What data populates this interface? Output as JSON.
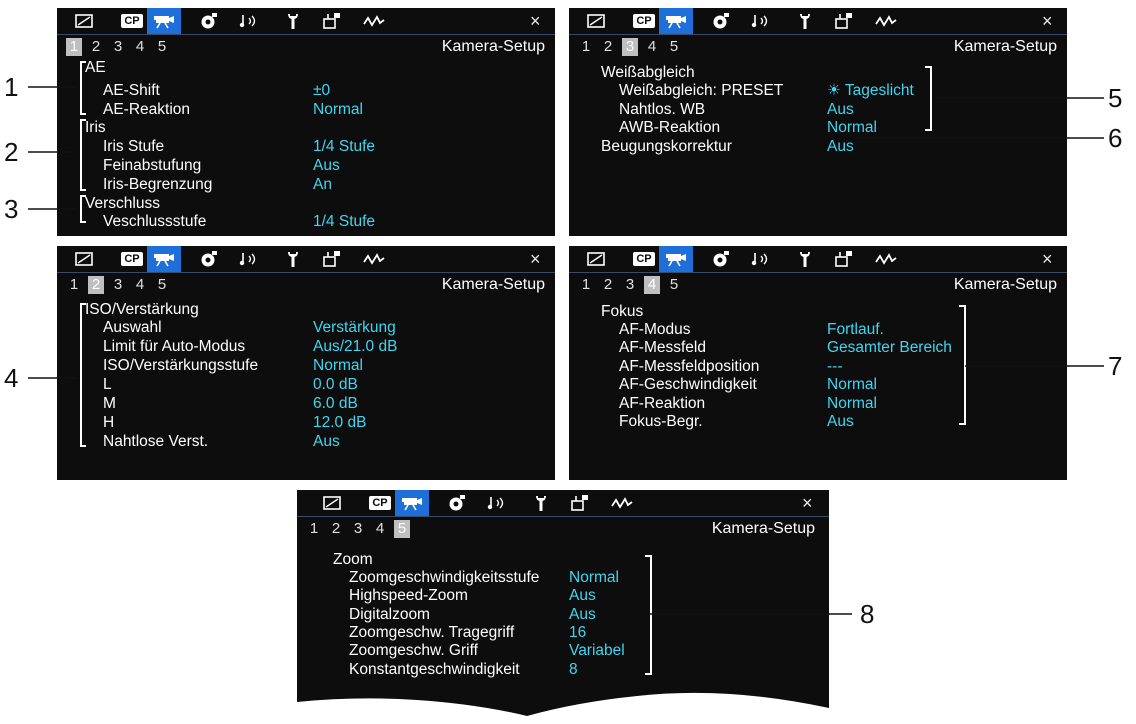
{
  "tabs": [
    {
      "name": "picture-icon"
    },
    {
      "name": "custom-picture-icon",
      "text": "CP"
    },
    {
      "name": "camera-icon"
    },
    {
      "name": "recording-icon"
    },
    {
      "name": "audio-icon"
    },
    {
      "name": "wrench-icon"
    },
    {
      "name": "assign-icon"
    },
    {
      "name": "wave-icon"
    }
  ],
  "close_label": "×",
  "menu_title": "Kamera-Setup",
  "page_numbers": [
    "1",
    "2",
    "3",
    "4",
    "5"
  ],
  "accent_color": "#1f6fd8",
  "value_color": "#3fd6f0",
  "panels": [
    {
      "active_page": 0,
      "rows": [
        {
          "label": "AE",
          "value": ""
        },
        {
          "label": "AE-Shift",
          "value": "±0"
        },
        {
          "label": "AE-Reaktion",
          "value": "Normal"
        },
        {
          "label": "Iris",
          "value": ""
        },
        {
          "label": "Iris Stufe",
          "value": "1/4 Stufe"
        },
        {
          "label": "Feinabstufung",
          "value": "Aus"
        },
        {
          "label": "Iris-Begrenzung",
          "value": "An"
        },
        {
          "label": "Verschluss",
          "value": ""
        },
        {
          "label": "Veschlussstufe",
          "value": "1/4 Stufe"
        }
      ]
    },
    {
      "active_page": 2,
      "rows": [
        {
          "label": "Weißabgleich",
          "value": ""
        },
        {
          "label": "Weißabgleich: PRESET",
          "value": "Tageslicht"
        },
        {
          "label": "Nahtlos. WB",
          "value": "Aus"
        },
        {
          "label": "AWB-Reaktion",
          "value": "Normal"
        },
        {
          "label": "Beugungskorrektur",
          "value": "Aus"
        }
      ]
    },
    {
      "active_page": 1,
      "rows": [
        {
          "label": "ISO/Verstärkung",
          "value": ""
        },
        {
          "label": "Auswahl",
          "value": "Verstärkung"
        },
        {
          "label": "Limit für Auto-Modus",
          "value": "Aus/21.0 dB"
        },
        {
          "label": "ISO/Verstärkungsstufe",
          "value": "Normal"
        },
        {
          "label": "L",
          "value": "0.0 dB"
        },
        {
          "label": "M",
          "value": "6.0 dB"
        },
        {
          "label": "H",
          "value": "12.0 dB"
        },
        {
          "label": "Nahtlose Verst.",
          "value": "Aus"
        }
      ]
    },
    {
      "active_page": 3,
      "rows": [
        {
          "label": "Fokus",
          "value": ""
        },
        {
          "label": "AF-Modus",
          "value": "Fortlauf."
        },
        {
          "label": "AF-Messfeld",
          "value": "Gesamter Bereich"
        },
        {
          "label": "AF-Messfeldposition",
          "value": "---"
        },
        {
          "label": "AF-Geschwindigkeit",
          "value": "Normal"
        },
        {
          "label": "AF-Reaktion",
          "value": "Normal"
        },
        {
          "label": "Fokus-Begr.",
          "value": "Aus"
        }
      ]
    },
    {
      "active_page": 4,
      "rows": [
        {
          "label": "Zoom",
          "value": ""
        },
        {
          "label": "Zoomgeschwindigkeitsstufe",
          "value": "Normal"
        },
        {
          "label": "Highspeed-Zoom",
          "value": "Aus"
        },
        {
          "label": "Digitalzoom",
          "value": "Aus"
        },
        {
          "label": "Zoomgeschw. Tragegriff",
          "value": "16"
        },
        {
          "label": "Zoomgeschw. Griff",
          "value": "Variabel"
        },
        {
          "label": "Konstantgeschwindigkeit",
          "value": "8"
        }
      ]
    }
  ],
  "callouts": [
    "1",
    "2",
    "3",
    "4",
    "5",
    "6",
    "7",
    "8"
  ]
}
